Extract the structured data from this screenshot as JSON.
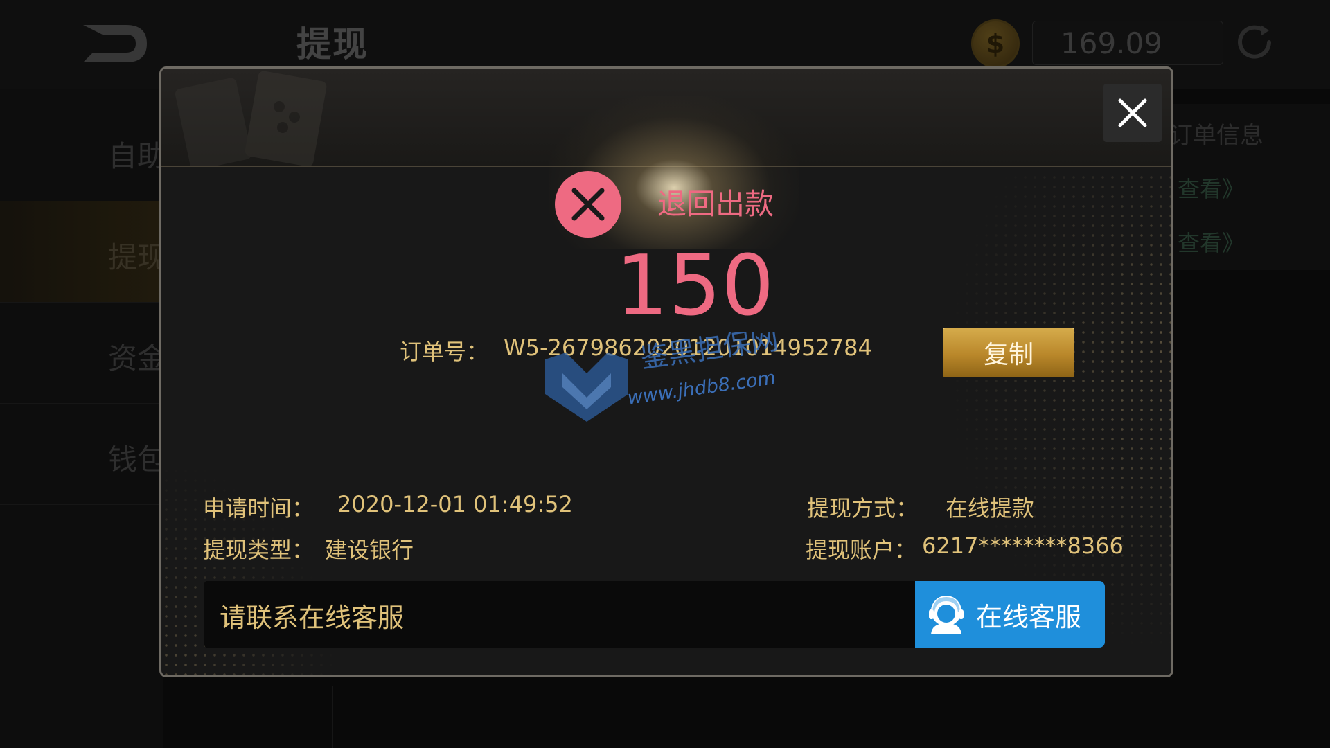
{
  "header": {
    "title": "提现",
    "balance": "169.09",
    "coin_symbol": "$"
  },
  "side_menu": {
    "items": [
      {
        "label": "自助"
      },
      {
        "label": "提现"
      },
      {
        "label": "资金"
      },
      {
        "label": "钱包"
      }
    ]
  },
  "right_panel": {
    "title": "订单信息",
    "links": [
      "查看》",
      "查看》"
    ]
  },
  "dialog": {
    "status_text": "退回出款",
    "amount": "150",
    "order_label": "订单号：",
    "order_number": "W5-26798620201201014952784",
    "copy_label": "复制",
    "apply_time_label": "申请时间：",
    "apply_time_value": "2020-12-01 01:49:52",
    "method_label": "提现方式：",
    "method_value": "在线提款",
    "type_label": "提现类型：",
    "type_value": "建设银行",
    "account_label": "提现账户：",
    "account_value": "6217********8366",
    "contact_text": "请联系在线客服",
    "cs_button_label": "在线客服"
  },
  "watermark": {
    "title": "鉴黑担保网",
    "url": "www.jhdb8.com"
  },
  "colors": {
    "accent_pink": "#ee6a82",
    "gold_text": "#e0c27a",
    "cs_blue": "#1f8fdb",
    "copy_gold": "#c8962f"
  }
}
